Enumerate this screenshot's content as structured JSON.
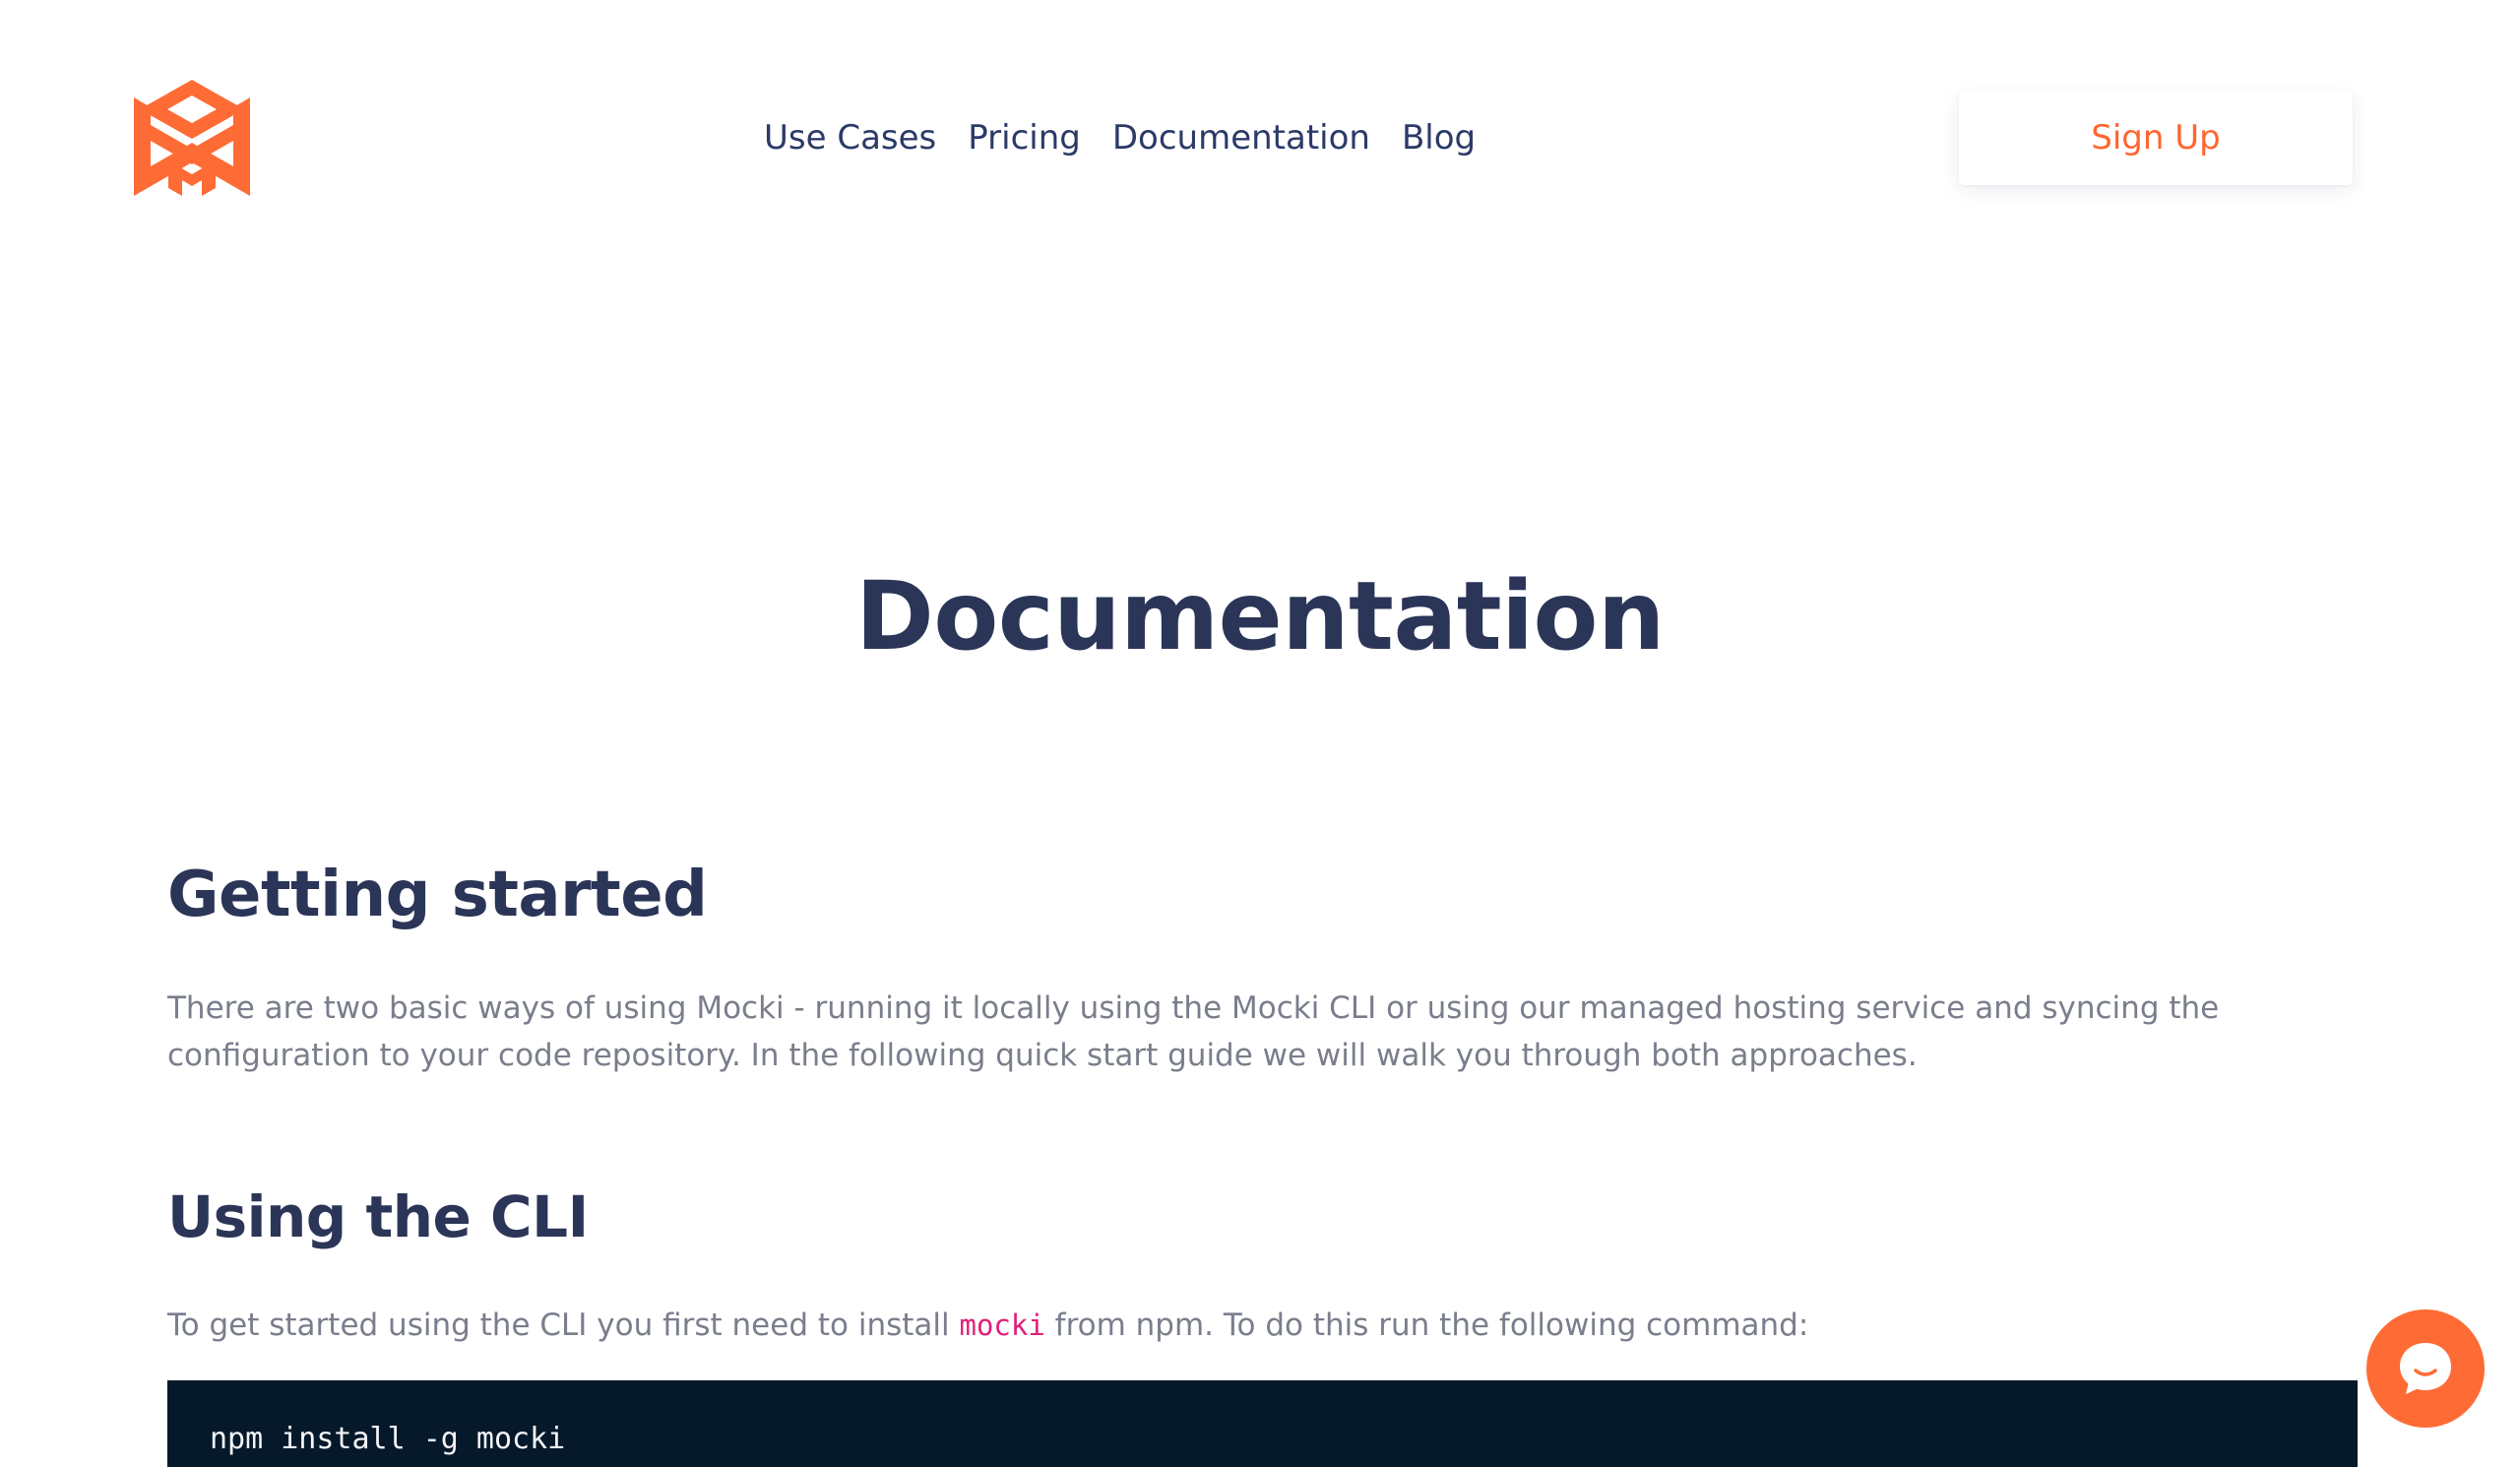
{
  "header": {
    "logo_icon": "mocki-logo-icon",
    "nav": [
      {
        "label": "Use Cases"
      },
      {
        "label": "Pricing"
      },
      {
        "label": "Documentation"
      },
      {
        "label": "Blog"
      }
    ],
    "signup_label": "Sign Up"
  },
  "main": {
    "title": "Documentation",
    "sections": [
      {
        "heading": "Getting started",
        "paragraph": "There are two basic ways of using Mocki - running it locally using the Mocki CLI or using our managed hosting service and syncing the configuration to your code repository. In the following quick start guide we will walk you through both approaches."
      },
      {
        "heading": "Using the CLI",
        "paragraph_before": "To get started using the CLI you first need to install",
        "inline_code": "mocki",
        "paragraph_after": "from npm. To do this run the following command:",
        "code": "npm install -g mocki"
      }
    ]
  },
  "chat_widget": {
    "icon": "chat-bubble-icon"
  },
  "colors": {
    "accent": "#ff6630",
    "heading": "#2b3558",
    "nav_text": "#2b3a67",
    "body_text": "#7a7e8c",
    "code_background": "#06192a",
    "inline_code": "#e0207a"
  }
}
